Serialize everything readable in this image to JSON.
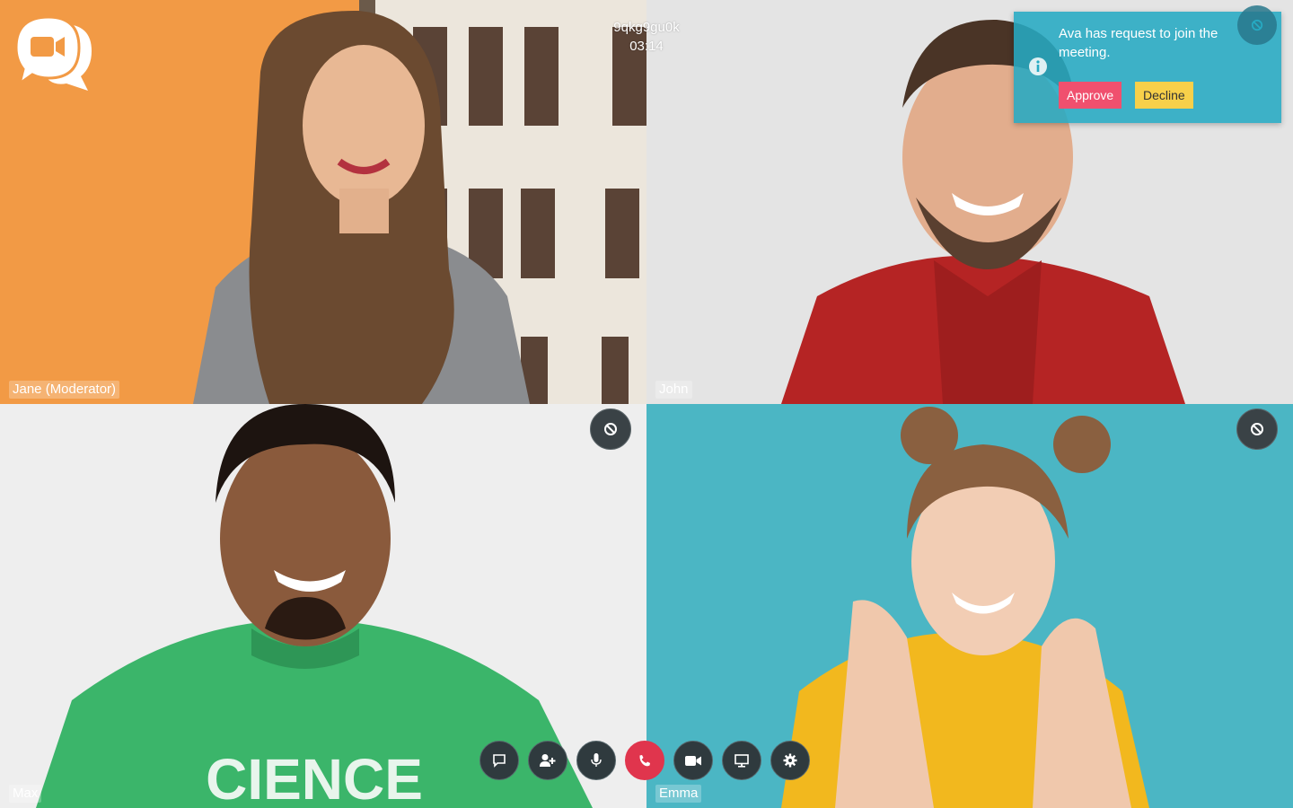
{
  "meeting": {
    "room_id": "9qkg9gu0k",
    "elapsed": "03:14"
  },
  "participants": [
    {
      "name": "Jane (Moderator)"
    },
    {
      "name": "John"
    },
    {
      "name": "Max"
    },
    {
      "name": "Emma"
    }
  ],
  "notification": {
    "message": "Ava has request to join the meeting.",
    "approve_label": "Approve",
    "decline_label": "Decline"
  },
  "controls": [
    {
      "icon": "chat-icon"
    },
    {
      "icon": "add-user-icon"
    },
    {
      "icon": "microphone-icon"
    },
    {
      "icon": "hang-up-icon"
    },
    {
      "icon": "video-camera-icon"
    },
    {
      "icon": "screen-share-icon"
    },
    {
      "icon": "settings-icon"
    }
  ],
  "colors": {
    "accent": "#26aac3",
    "approve": "#f0506e",
    "decline": "#f7d04a",
    "hangup": "#e0354d"
  }
}
